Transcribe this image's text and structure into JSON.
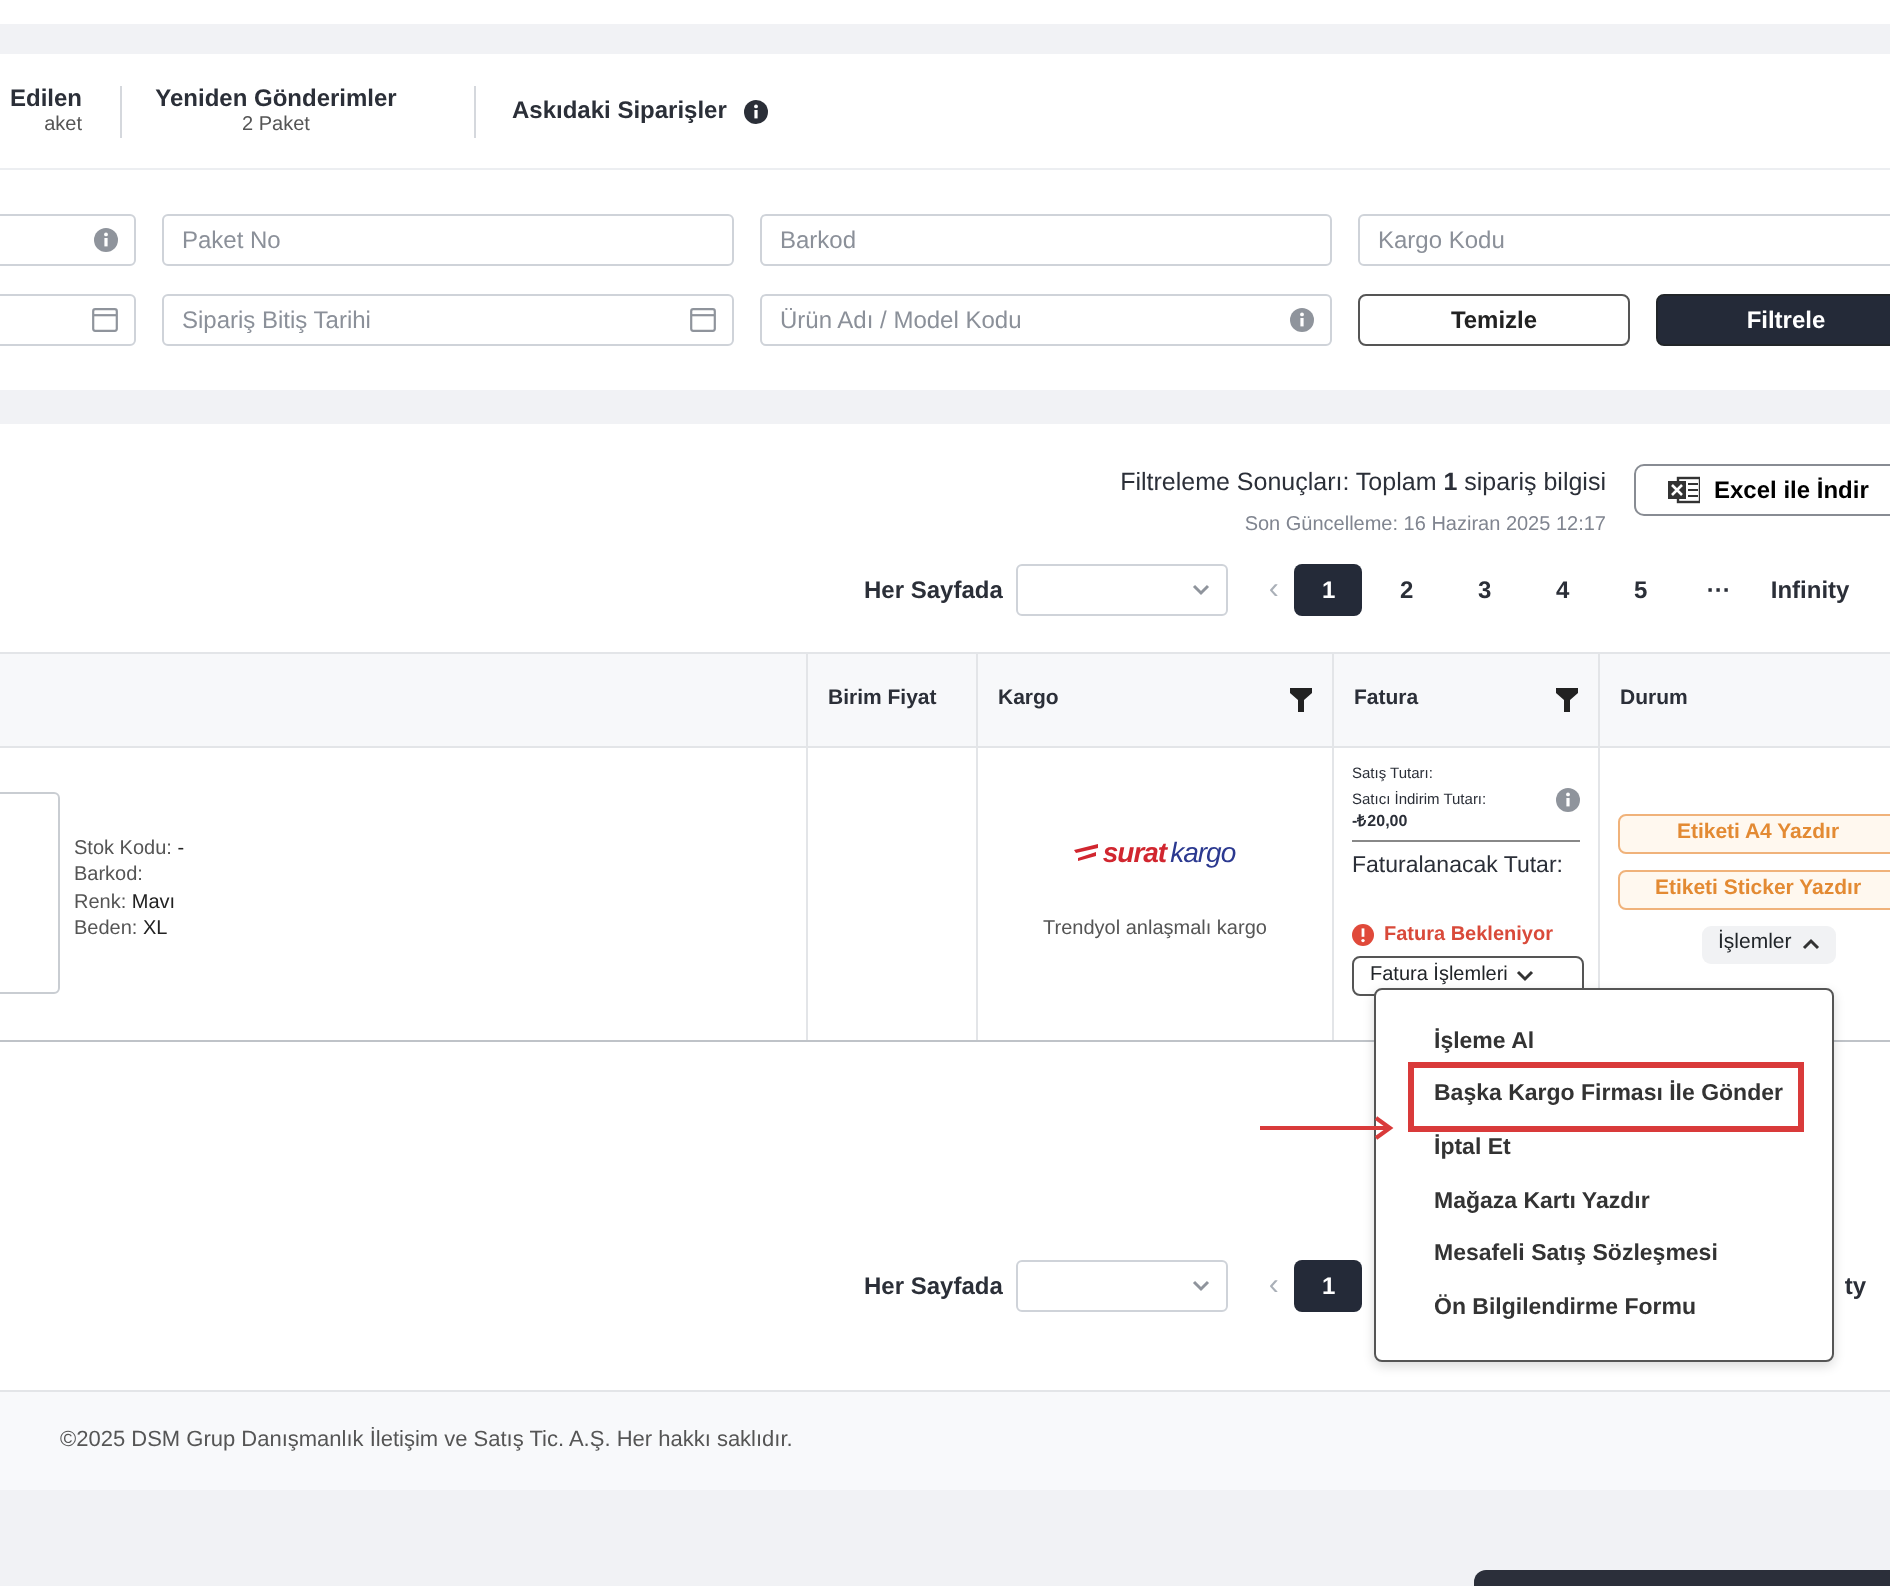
{
  "tabs": [
    {
      "title": "Edilen",
      "subtitle": "aket"
    },
    {
      "title": "Yeniden Gönderimler",
      "subtitle": "2 Paket"
    },
    {
      "title": "Askıdaki Siparişler",
      "info": true
    }
  ],
  "filters": [
    [
      {
        "kind": "input"
      },
      {
        "kind": "input",
        "placeholder": "Paket No"
      },
      {
        "kind": "input",
        "placeholder": "Barkod"
      },
      {
        "kind": "input",
        "placeholder": "Kargo Kodu"
      }
    ],
    [
      {
        "kind": "input"
      },
      {
        "kind": "input",
        "placeholder": "Sipariş Bitiş Tarihi"
      },
      {
        "kind": "input",
        "placeholder": "Ürün Adı / Model Kodu"
      },
      {
        "kind": "button",
        "label": "Temizle"
      },
      {
        "kind": "button",
        "label": "Filtrele"
      }
    ]
  ],
  "results": {
    "summary": "Filtreleme Sonuçları: Toplam **1** sipariş bilgisi",
    "updated": "Son Güncelleme: 16 Haziran 2025 12:17",
    "export_button": "Excel ile İndir"
  },
  "pagination_top": {
    "label": "Her Sayfada",
    "prev": "‹",
    "pages": [
      {
        "label": "1",
        "selected": true
      },
      {
        "label": "2",
        "selected": false
      },
      {
        "label": "3",
        "selected": false
      },
      {
        "label": "4",
        "selected": false
      },
      {
        "label": "5",
        "selected": false
      },
      {
        "label": "···",
        "selected": false
      },
      {
        "label": "Infinity",
        "selected": false
      }
    ]
  },
  "table": {
    "columns": [
      {
        "label": "Birim Fiyat"
      },
      {
        "label": "Kargo",
        "filter": true
      },
      {
        "label": "Fatura",
        "filter": true
      },
      {
        "label": "Durum"
      }
    ],
    "row": {
      "details": [
        {
          "label": "Stok Kodu:",
          "value": "-"
        },
        {
          "label": "Barkod:"
        },
        {
          "label": "Renk:",
          "value": "Mavı"
        },
        {
          "label": "Beden:",
          "value": "XL"
        }
      ],
      "cargo": {
        "logo": [
          "surat",
          "kargo"
        ],
        "note": "Trendyol anlaşmalı kargo"
      },
      "invoice": {
        "sales_label": "Satış Tutarı:",
        "discount_label": "Satıcı İndirim Tutarı:",
        "discount_value": "-₺20,00",
        "billable_label": "Faturalanacak Tutar:",
        "status": "Fatura Bekleniyor",
        "actions_button": "Fatura İşlemleri"
      },
      "status": {
        "buttons": [
          "Etiketi A4 Yazdır",
          "Etiketi Sticker Yazdır"
        ],
        "actions": {
          "label": "İşlemler",
          "expanded": true
        }
      }
    }
  },
  "menu": [
    {
      "label": "İşleme Al",
      "highlighted": false
    },
    {
      "label": "Başka Kargo Firması İle Gönder",
      "highlighted": true
    },
    {
      "label": "İptal Et",
      "highlighted": false
    },
    {
      "label": "Mağaza Kartı Yazdır",
      "highlighted": false
    },
    {
      "label": "Mesafeli Satış Sözleşmesi",
      "highlighted": false
    },
    {
      "label": "Ön Bilgilendirme Formu",
      "highlighted": false
    }
  ],
  "pagination_bottom": {
    "label": "Her Sayfada",
    "prev": "‹",
    "pages": [
      {
        "label": "1",
        "selected": true
      }
    ],
    "tail": "ty"
  },
  "footer": "©2025 DSM Grup Danışmanlık İletişim ve Satış Tic. A.Ş. Her hakkı saklıdır."
}
